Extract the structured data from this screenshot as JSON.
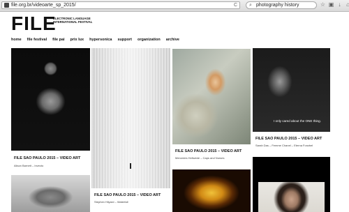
{
  "browser": {
    "url": "file.org.br/videoarte_sp_2015/",
    "search_query": "photography history",
    "reload_glyph": "C",
    "search_glyph": "⌕",
    "toolbar_icons": [
      "star-icon",
      "bookmark-icon",
      "download-icon",
      "home-icon",
      "shield-icon",
      "menu-icon"
    ],
    "toolbar_glyphs": [
      "☆",
      "▣",
      "↓",
      "⌂",
      "◈",
      "≡"
    ]
  },
  "site": {
    "logo": "FILE",
    "logo_subtitle": "ELECTRONIC LANGUAGE INTERNATIONAL FESTIVAL",
    "nav": [
      "home",
      "file festival",
      "file pai",
      "prix lux",
      "hypersonica",
      "support",
      "organization",
      "archive"
    ]
  },
  "cards": [
    {
      "title": "FILE SAO PAULO 2015 – VIDEO ART",
      "subtitle": "Alison Barnett – Invecto"
    },
    {
      "title": "FILE SAO PAULO 2015 – VIDEO ART",
      "subtitle": "Stephen Hilyard – Waterfall"
    },
    {
      "title": "FILE SAO PAULO 2015 – VIDEO ART",
      "subtitle": "Mercedes Hellwede – Caps and Nurses"
    },
    {
      "title": "FILE SAO PAULO 2015 – VIDEO ART",
      "subtitle": "Sarah Das – Femme Chanel – Eterna Fonzbel",
      "overlay": "I only cared about the ONE thing."
    }
  ]
}
